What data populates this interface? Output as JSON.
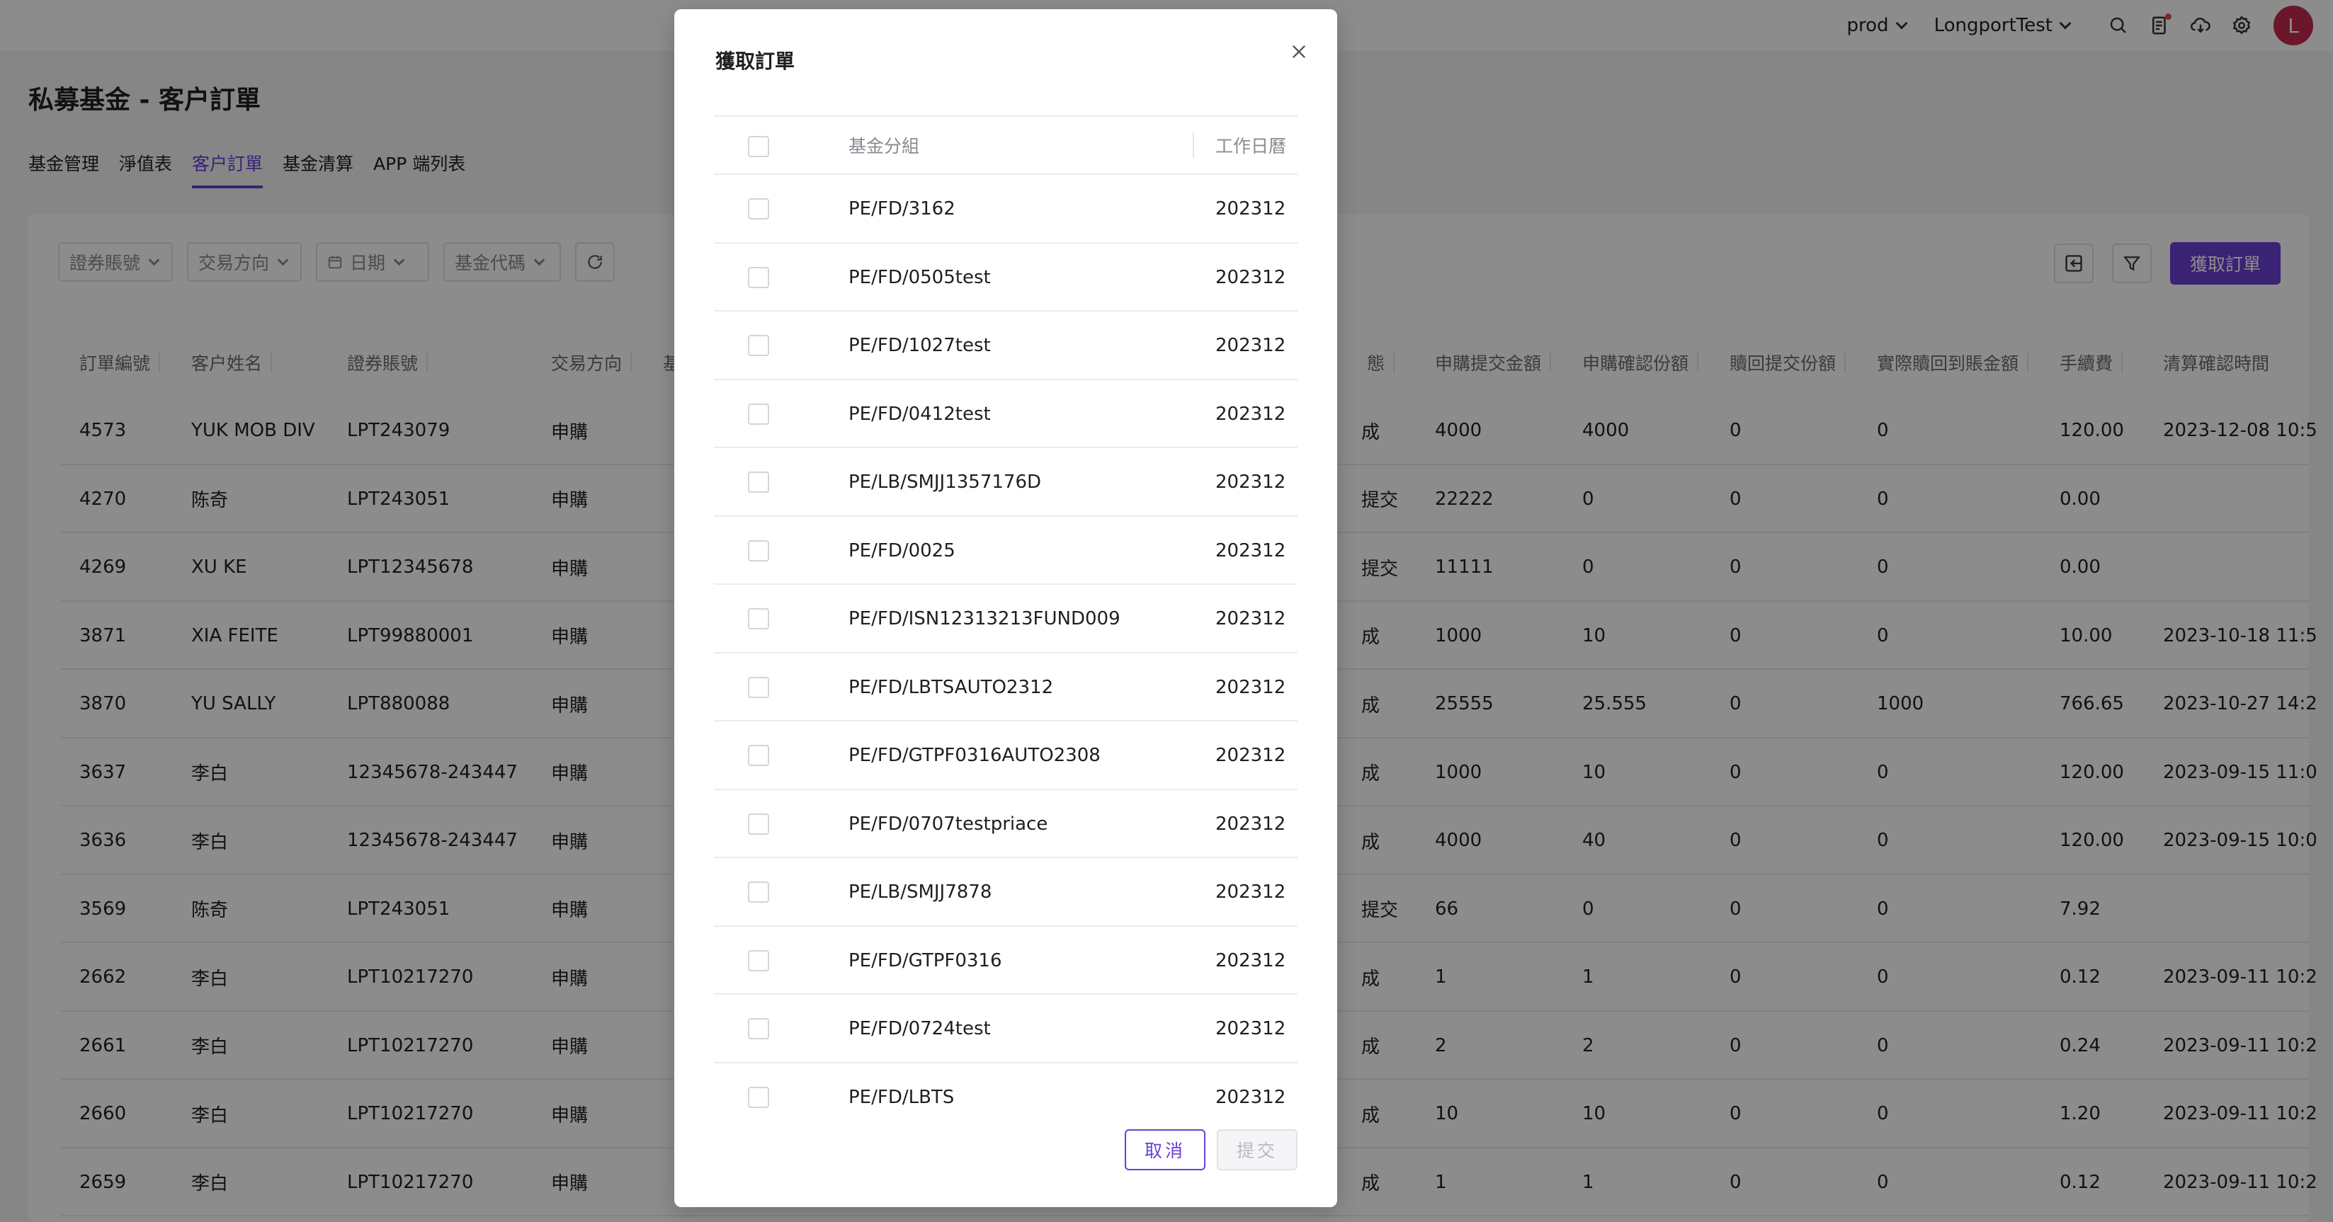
{
  "topbar": {
    "env": "prod",
    "account": "LongportTest",
    "avatar_letter": "L"
  },
  "page": {
    "title": "私募基金 - 客户訂單",
    "tabs": [
      "基金管理",
      "淨值表",
      "客户訂單",
      "基金清算",
      "APP 端列表"
    ],
    "active_tab": "客户訂單"
  },
  "filters": {
    "account": "證券賬號",
    "direction": "交易方向",
    "date": "日期",
    "fund_code": "基金代碼"
  },
  "actions": {
    "fetch_orders": "獲取訂單"
  },
  "table": {
    "left_columns": [
      "訂單編號",
      "客户姓名",
      "證券賬號",
      "交易方向"
    ],
    "partial_column": "基",
    "right_partial_column": "態",
    "right_columns": [
      "申購提交金額",
      "申購確認份額",
      "贖回提交份額",
      "實際贖回到賬金額",
      "手續費",
      "清算確認時間"
    ],
    "rows": [
      {
        "id": "4573",
        "name": "YUK MOB DIV",
        "account": "LPT243079",
        "dir": "申購",
        "p": "P",
        "status": "成",
        "sub_amt": "4000",
        "sub_conf": "4000",
        "red_sub": "0",
        "red_amt": "0",
        "fee": "120.00",
        "time": "2023-12-08 10:5"
      },
      {
        "id": "4270",
        "name": "陈奇",
        "account": "LPT243051",
        "dir": "申購",
        "p": "P",
        "status": "提交",
        "sub_amt": "22222",
        "sub_conf": "0",
        "red_sub": "0",
        "red_amt": "0",
        "fee": "0.00",
        "time": ""
      },
      {
        "id": "4269",
        "name": "XU KE",
        "account": "LPT12345678",
        "dir": "申購",
        "p": "P",
        "status": "提交",
        "sub_amt": "11111",
        "sub_conf": "0",
        "red_sub": "0",
        "red_amt": "0",
        "fee": "0.00",
        "time": ""
      },
      {
        "id": "3871",
        "name": "XIA FEITE",
        "account": "LPT99880001",
        "dir": "申購",
        "p": "P",
        "status": "成",
        "sub_amt": "1000",
        "sub_conf": "10",
        "red_sub": "0",
        "red_amt": "0",
        "fee": "10.00",
        "time": "2023-10-18 11:5"
      },
      {
        "id": "3870",
        "name": "YU SALLY",
        "account": "LPT880088",
        "dir": "申購",
        "p": "P",
        "status": "成",
        "sub_amt": "25555",
        "sub_conf": "25.555",
        "red_sub": "0",
        "red_amt": "1000",
        "fee": "766.65",
        "time": "2023-10-27 14:2"
      },
      {
        "id": "3637",
        "name": "李白",
        "account": "12345678-243447",
        "dir": "申購",
        "p": "P",
        "status": "成",
        "sub_amt": "1000",
        "sub_conf": "10",
        "red_sub": "0",
        "red_amt": "0",
        "fee": "120.00",
        "time": "2023-09-15 11:0"
      },
      {
        "id": "3636",
        "name": "李白",
        "account": "12345678-243447",
        "dir": "申購",
        "p": "P",
        "status": "成",
        "sub_amt": "4000",
        "sub_conf": "40",
        "red_sub": "0",
        "red_amt": "0",
        "fee": "120.00",
        "time": "2023-09-15 10:0"
      },
      {
        "id": "3569",
        "name": "陈奇",
        "account": "LPT243051",
        "dir": "申購",
        "p": "P",
        "status": "提交",
        "sub_amt": "66",
        "sub_conf": "0",
        "red_sub": "0",
        "red_amt": "0",
        "fee": "7.92",
        "time": ""
      },
      {
        "id": "2662",
        "name": "李白",
        "account": "LPT10217270",
        "dir": "申購",
        "p": "P",
        "status": "成",
        "sub_amt": "1",
        "sub_conf": "1",
        "red_sub": "0",
        "red_amt": "0",
        "fee": "0.12",
        "time": "2023-09-11 10:2"
      },
      {
        "id": "2661",
        "name": "李白",
        "account": "LPT10217270",
        "dir": "申購",
        "p": "P",
        "status": "成",
        "sub_amt": "2",
        "sub_conf": "2",
        "red_sub": "0",
        "red_amt": "0",
        "fee": "0.24",
        "time": "2023-09-11 10:2"
      },
      {
        "id": "2660",
        "name": "李白",
        "account": "LPT10217270",
        "dir": "申購",
        "p": "P",
        "status": "成",
        "sub_amt": "10",
        "sub_conf": "10",
        "red_sub": "0",
        "red_amt": "0",
        "fee": "1.20",
        "time": "2023-09-11 10:2"
      },
      {
        "id": "2659",
        "name": "李白",
        "account": "LPT10217270",
        "dir": "申購",
        "p": "P",
        "status": "成",
        "sub_amt": "1",
        "sub_conf": "1",
        "red_sub": "0",
        "red_amt": "0",
        "fee": "0.12",
        "time": "2023-09-11 10:2"
      }
    ]
  },
  "modal": {
    "title": "獲取訂單",
    "col_group": "基金分組",
    "col_calendar": "工作日曆",
    "rows": [
      {
        "group": "PE/FD/3162",
        "calendar": "202312"
      },
      {
        "group": "PE/FD/0505test",
        "calendar": "202312"
      },
      {
        "group": "PE/FD/1027test",
        "calendar": "202312"
      },
      {
        "group": "PE/FD/0412test",
        "calendar": "202312"
      },
      {
        "group": "PE/LB/SMJJ1357176D",
        "calendar": "202312"
      },
      {
        "group": "PE/FD/0025",
        "calendar": "202312"
      },
      {
        "group": "PE/FD/ISN12313213FUND009",
        "calendar": "202312"
      },
      {
        "group": "PE/FD/LBTSAUTO2312",
        "calendar": "202312"
      },
      {
        "group": "PE/FD/GTPF0316AUTO2308",
        "calendar": "202312"
      },
      {
        "group": "PE/FD/0707testpriace",
        "calendar": "202312"
      },
      {
        "group": "PE/LB/SMJJ7878",
        "calendar": "202312"
      },
      {
        "group": "PE/FD/GTPF0316",
        "calendar": "202312"
      },
      {
        "group": "PE/FD/0724test",
        "calendar": "202312"
      },
      {
        "group": "PE/FD/LBTS",
        "calendar": "202312"
      }
    ],
    "cancel": "取消",
    "submit": "提交"
  },
  "colors": {
    "accent": "#6b3fd6",
    "overlay": "rgba(0,0,0,0.45)",
    "avatar": "#c3284f"
  }
}
